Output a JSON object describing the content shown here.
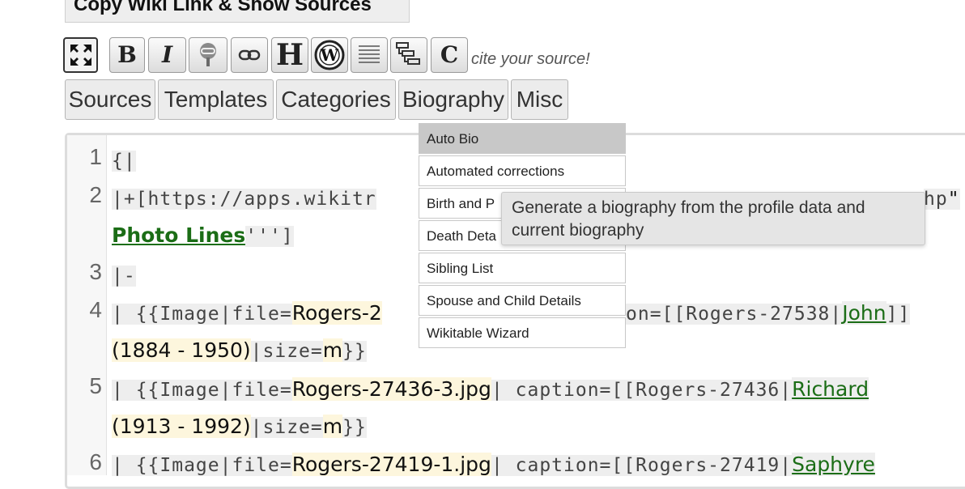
{
  "top_button": {
    "label": "Copy Wiki Link & Show Sources"
  },
  "toolbar": {
    "bold": "B",
    "italic": "I",
    "heading": "H",
    "wikipedia": "W",
    "cite": "C",
    "cite_hint": "cite your source!"
  },
  "tabs": [
    "Sources",
    "Templates",
    "Categories",
    "Biography",
    "Misc"
  ],
  "editor": {
    "line_numbers": [
      "1",
      "2",
      "3",
      "4",
      "5",
      "6"
    ],
    "lines": {
      "l1": "{|",
      "l2_a": "|+[https://apps.wikitr",
      "l2_b": "hp",
      "l2_c": "\"",
      "l2_link": "Photo Lines",
      "l2_tail": "''']",
      "l3": "|-",
      "l4_a": "| {{Image|file=",
      "l4_file": "Rogers-2",
      "l4_b": "on=[[Rogers-27538|",
      "l4_name": "John",
      "l4_c": "]]",
      "l4_years": "(1884 - 1950)",
      "l4_size": "|size=",
      "l4_m": "m",
      "l4_end": "}}",
      "l5_a": "| {{Image|file=",
      "l5_file": "Rogers-27436-3.jpg",
      "l5_b": "| caption=[[Rogers-27436|",
      "l5_name": "Richard",
      "l5_years": "(1913 - 1992)",
      "l5_size": "|size=",
      "l5_m": "m",
      "l5_end": "}}",
      "l6_a": "| {{Image|file=",
      "l6_file": "Rogers-27419-1.jpg",
      "l6_b": "| caption=[[Rogers-27419|",
      "l6_name": "Saphyre"
    }
  },
  "dropdown": {
    "items": [
      "Auto Bio",
      "Automated corrections",
      "Birth and P",
      "Death Deta",
      "Sibling List",
      "Spouse and Child Details",
      "Wikitable Wizard"
    ],
    "selected": "Auto Bio"
  },
  "tooltip": {
    "text": "Generate a biography from the profile data and current biography"
  },
  "icons": {
    "fullscreen": "expand-arrows-icon",
    "tree": "tree-link-icon",
    "link": "chain-link-icon",
    "wikipedia": "wikipedia-icon",
    "lines": "horizontal-lines-icon",
    "outline": "outline-tree-icon"
  }
}
